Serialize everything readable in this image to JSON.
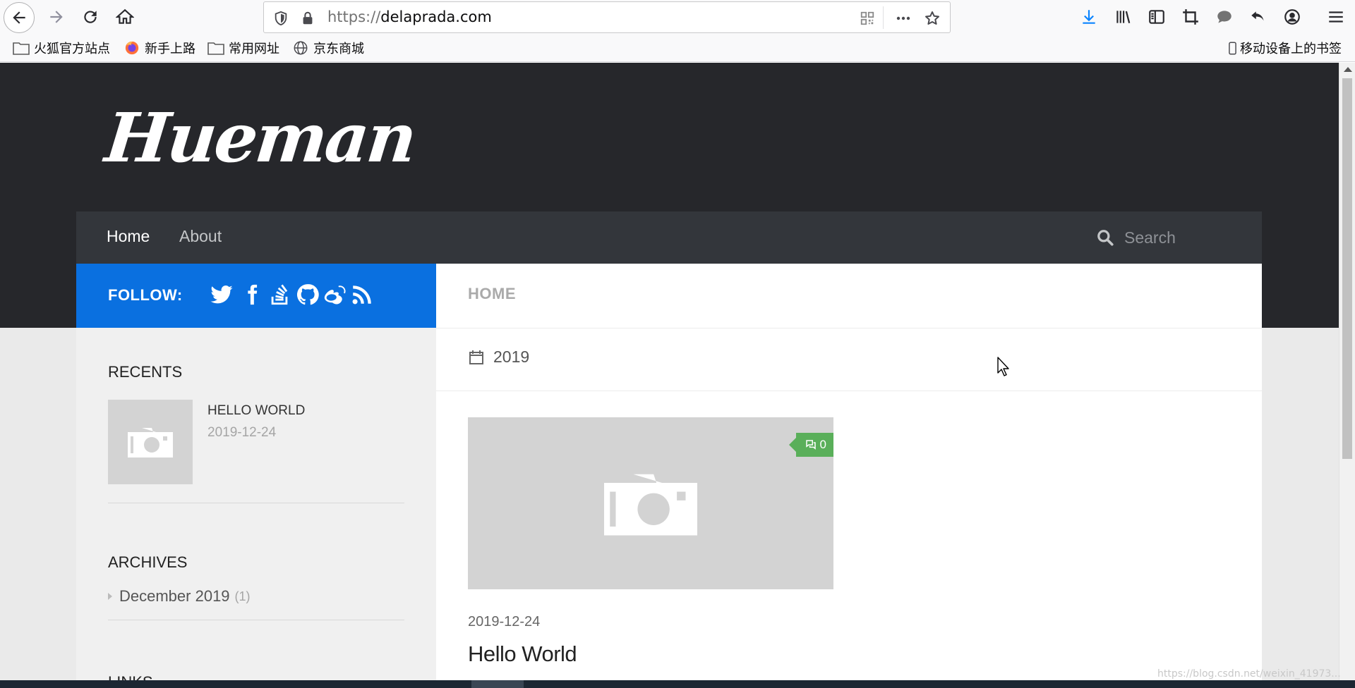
{
  "browser": {
    "url_scheme": "https://",
    "url_host": "delaprada.com",
    "bookmarks": [
      {
        "label": "火狐官方站点",
        "icon": "folder-icon"
      },
      {
        "label": "新手上路",
        "icon": "firefox-icon"
      },
      {
        "label": "常用网址",
        "icon": "folder-icon"
      },
      {
        "label": "京东商城",
        "icon": "globe-icon"
      }
    ],
    "mobile_bookmarks": "移动设备上的书签"
  },
  "site": {
    "logo": "Hueman",
    "nav": {
      "home": "Home",
      "about": "About"
    },
    "search": {
      "placeholder": "Search"
    },
    "follow": {
      "label": "FOLLOW:",
      "icons": [
        "twitter-icon",
        "facebook-icon",
        "stackoverflow-icon",
        "github-icon",
        "weibo-icon",
        "rss-icon"
      ]
    }
  },
  "sidebar": {
    "recents_title": "RECENTS",
    "recent": {
      "title": "HELLO WORLD",
      "date": "2019-12-24"
    },
    "archives_title": "ARCHIVES",
    "archive": {
      "label": "December 2019",
      "count": "(1)"
    },
    "links_title": "LINKS"
  },
  "main": {
    "breadcrumb": "HOME",
    "year": "2019",
    "post": {
      "comments": "0",
      "date": "2019-12-24",
      "title": "Hello World"
    }
  },
  "watermark": "https://blog.csdn.net/weixin_41973..."
}
